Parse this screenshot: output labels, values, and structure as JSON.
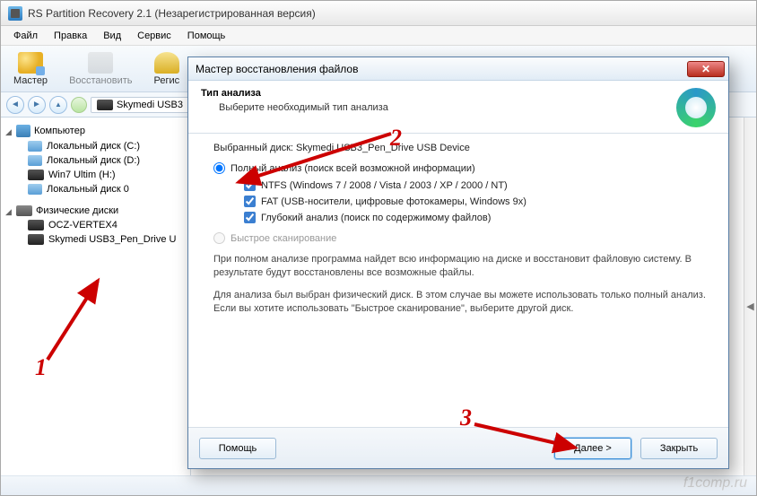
{
  "window": {
    "title": "RS Partition Recovery 2.1 (Незарегистрированная версия)"
  },
  "menu": {
    "file": "Файл",
    "edit": "Правка",
    "view": "Вид",
    "service": "Сервис",
    "help": "Помощь"
  },
  "toolbar": {
    "master": "Мастер",
    "restore": "Восстановить",
    "register": "Региc"
  },
  "nav": {
    "address": "Skymedi USB3"
  },
  "tree": {
    "computer": "Компьютер",
    "volumes": [
      "Локальный диск (C:)",
      "Локальный диск (D:)",
      "Win7 Ultim (H:)",
      "Локальный диск 0"
    ],
    "phys_head": "Физические диски",
    "phys": [
      "OCZ-VERTEX4",
      "Skymedi USB3_Pen_Drive U"
    ]
  },
  "dialog": {
    "title": "Мастер восстановления файлов",
    "heading": "Тип анализа",
    "subheading": "Выберите необходимый тип анализа",
    "selected_disk_label": "Выбранный диск:",
    "selected_disk": "Skymedi USB3_Pen_Drive USB Device",
    "radio_full": "Полный анализ (поиск всей возможной информации)",
    "chk_ntfs": "NTFS (Windows 7 / 2008 / Vista / 2003 / XP / 2000 / NT)",
    "chk_fat": "FAT (USB-носители, цифровые фотокамеры, Windows 9x)",
    "chk_deep": "Глубокий анализ (поиск по содержимому файлов)",
    "radio_quick": "Быстрое сканирование",
    "info1": "При полном анализе программа найдет всю информацию на диске и восстановит файловую систему. В результате будут восстановлены все возможные файлы.",
    "info2": "Для анализа был выбран физический диск. В этом случае вы можете использовать только полный анализ. Если вы хотите использовать \"Быстрое сканирование\", выберите другой диск.",
    "btn_help": "Помощь",
    "btn_next": "Далее >",
    "btn_close": "Закрыть"
  },
  "annotations": {
    "n1": "1",
    "n2": "2",
    "n3": "3"
  },
  "watermark": "f1comp.ru"
}
